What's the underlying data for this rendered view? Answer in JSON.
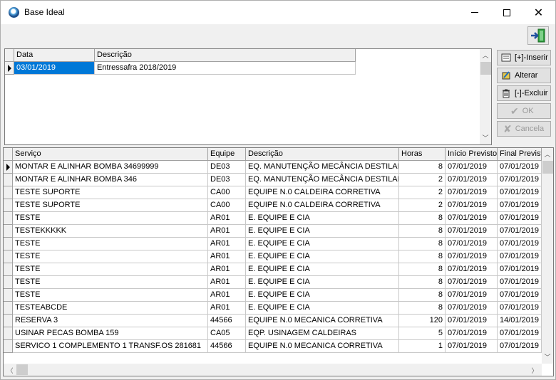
{
  "window": {
    "title": "Base Ideal"
  },
  "icons": {
    "app": "app-globe-icon",
    "exit": "exit-door-icon"
  },
  "top_grid": {
    "headers": [
      "Data",
      "Descrição"
    ],
    "rows": [
      [
        "03/01/2019",
        "Entressafra 2018/2019"
      ]
    ]
  },
  "side_buttons": {
    "inserir": "[+]-Inserir",
    "alterar": "Alterar",
    "excluir": "[-]-Excluir",
    "ok": "OK",
    "cancela": "Cancela"
  },
  "bottom_grid": {
    "headers": [
      "Serviço",
      "Equipe",
      "Descrição",
      "Horas",
      "Início Previsto",
      "Final Previsto"
    ],
    "rows": [
      [
        "MONTAR E ALINHAR BOMBA 34699999",
        "DE03",
        "EQ. MANUTENÇÃO MECÂNCIA DESTILAR",
        "8",
        "07/01/2019",
        "07/01/2019"
      ],
      [
        "MONTAR E ALINHAR BOMBA 346",
        "DE03",
        "EQ. MANUTENÇÃO MECÂNCIA DESTILAR",
        "2",
        "07/01/2019",
        "07/01/2019"
      ],
      [
        "TESTE SUPORTE",
        "CA00",
        "EQUIPE N.0 CALDEIRA CORRETIVA",
        "2",
        "07/01/2019",
        "07/01/2019"
      ],
      [
        "TESTE SUPORTE",
        "CA00",
        "EQUIPE N.0 CALDEIRA CORRETIVA",
        "2",
        "07/01/2019",
        "07/01/2019"
      ],
      [
        "TESTE",
        "AR01",
        "E. EQUIPE E CIA",
        "8",
        "07/01/2019",
        "07/01/2019"
      ],
      [
        "TESTEKKKKK",
        "AR01",
        "E. EQUIPE E CIA",
        "8",
        "07/01/2019",
        "07/01/2019"
      ],
      [
        "TESTE",
        "AR01",
        "E. EQUIPE E CIA",
        "8",
        "07/01/2019",
        "07/01/2019"
      ],
      [
        "TESTE",
        "AR01",
        "E. EQUIPE E CIA",
        "8",
        "07/01/2019",
        "07/01/2019"
      ],
      [
        "TESTE",
        "AR01",
        "E. EQUIPE E CIA",
        "8",
        "07/01/2019",
        "07/01/2019"
      ],
      [
        "TESTE",
        "AR01",
        "E. EQUIPE E CIA",
        "8",
        "07/01/2019",
        "07/01/2019"
      ],
      [
        "TESTE",
        "AR01",
        "E. EQUIPE E CIA",
        "8",
        "07/01/2019",
        "07/01/2019"
      ],
      [
        "TESTEABCDE",
        "AR01",
        "E. EQUIPE E CIA",
        "8",
        "07/01/2019",
        "07/01/2019"
      ],
      [
        "RESERVA 3",
        "44566",
        "EQUIPE N.0 MECANICA CORRETIVA",
        "120",
        "07/01/2019",
        "14/01/2019"
      ],
      [
        "USINAR PECAS BOMBA 159",
        "CA05",
        "EQP. USINAGEM CALDEIRAS",
        "5",
        "07/01/2019",
        "07/01/2019"
      ],
      [
        "SERVICO 1 COMPLEMENTO 1 TRANSF.OS 281681",
        "44566",
        "EQUIPE N.0 MECANICA CORRETIVA",
        "1",
        "07/01/2019",
        "07/01/2019"
      ]
    ]
  },
  "colors": {
    "selection": "#0078d7",
    "accent_green": "#2e9e3e"
  }
}
